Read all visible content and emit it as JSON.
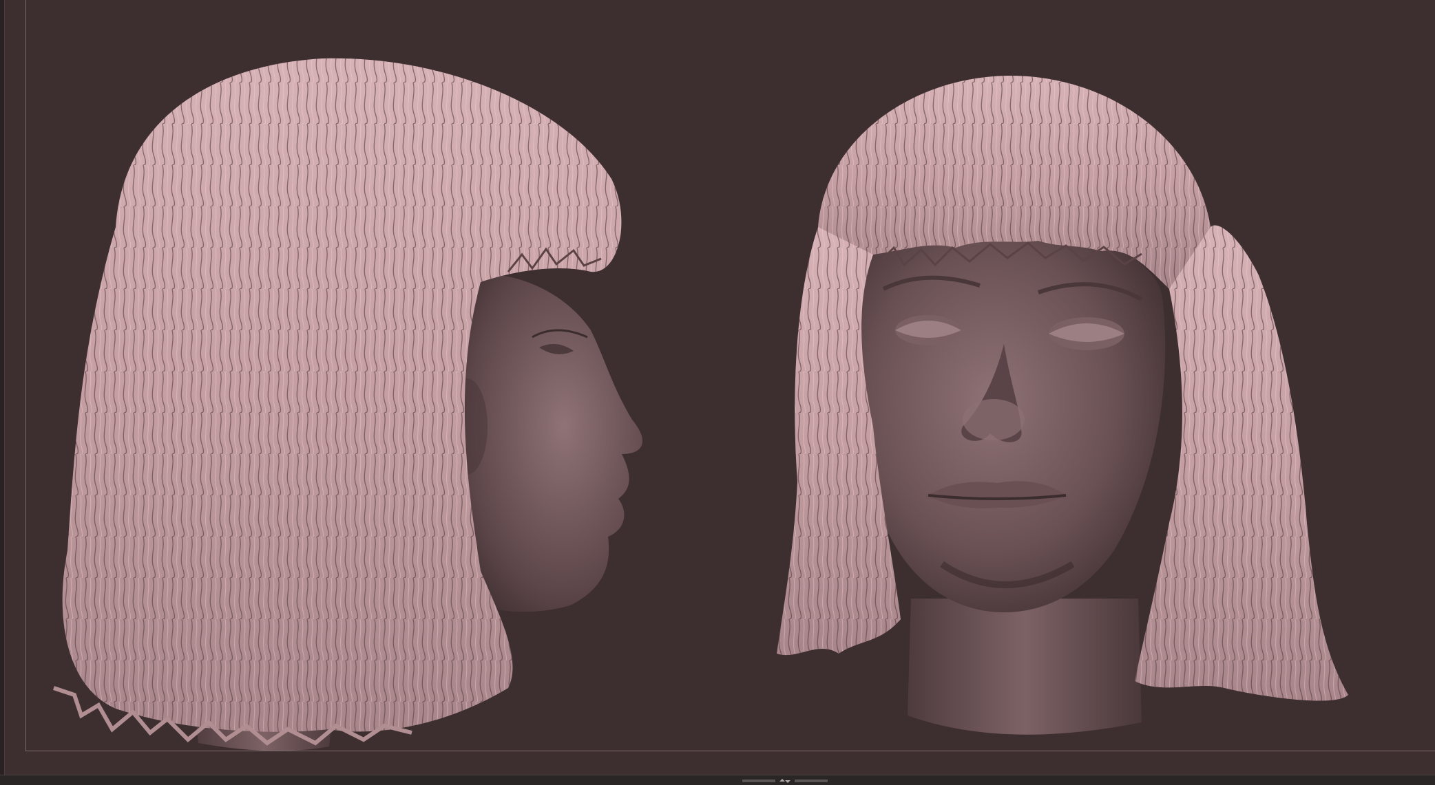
{
  "viewport": {
    "background_color": "#3d2e2f",
    "border_color": "#7a6a6b",
    "subjects": [
      {
        "name": "head-profile-view",
        "material_color": "#c9a4a8"
      },
      {
        "name": "head-front-view",
        "material_color": "#c9a4a8"
      }
    ]
  },
  "bottom_bar": {
    "handle_icon": "collapse-expand-arrows-icon"
  }
}
